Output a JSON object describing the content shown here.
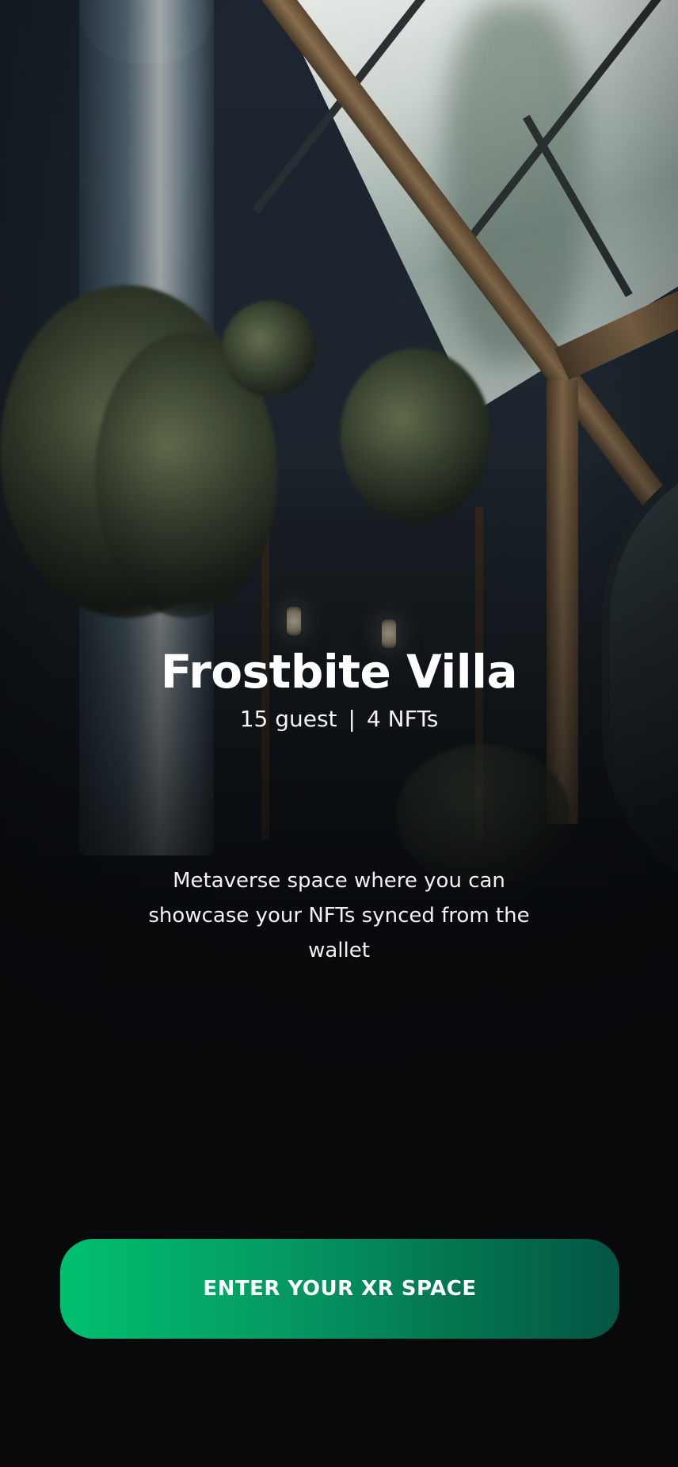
{
  "space": {
    "title": "Frostbite Villa",
    "guests": "15 guest",
    "separator": "|",
    "nfts": "4 NFTs",
    "description": "Metaverse space where you can showcase your NFTs synced from the wallet"
  },
  "cta": {
    "label": "ENTER YOUR XR SPACE",
    "gradient_start": "#00c06f",
    "gradient_end": "#045644"
  },
  "background": {
    "description_icon": "interior-scene-image",
    "base_color": "#07090b"
  }
}
